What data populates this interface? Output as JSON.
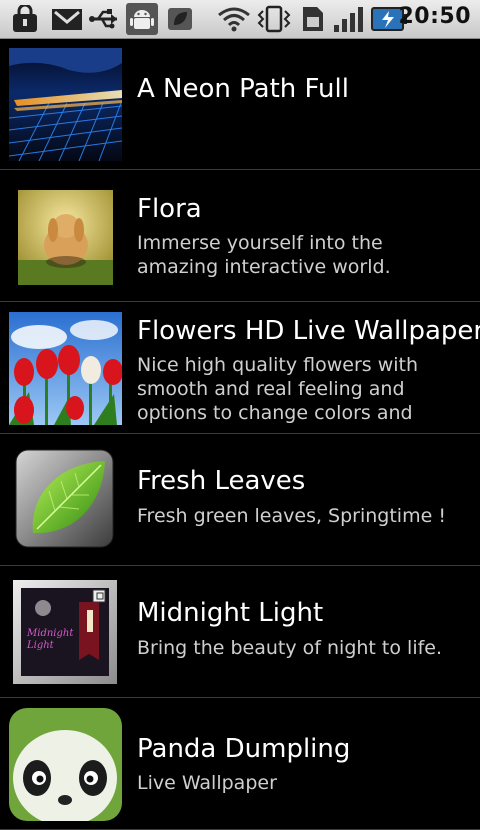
{
  "status_bar": {
    "time": "20:50",
    "icons": [
      "lock-icon",
      "gmail-icon",
      "usb-icon",
      "android-debug-icon",
      "leaf-icon",
      "wifi-icon",
      "vibrate-icon",
      "sim-icon",
      "signal-icon",
      "battery-charging-icon"
    ]
  },
  "colors": {
    "background": "#000000",
    "divider": "#3a3a3a",
    "title": "#ffffff",
    "description": "#cfcfcf"
  },
  "items": [
    {
      "title": "A Neon Path Full",
      "description": ""
    },
    {
      "title": "Flora",
      "description": "Immerse yourself into the amazing interactive world."
    },
    {
      "title": "Flowers HD Live Wallpaper",
      "description": "Nice high quality flowers with smooth and real feeling and options to change colors and"
    },
    {
      "title": "Fresh Leaves",
      "description": "Fresh green leaves, Springtime !"
    },
    {
      "title": "Midnight Light",
      "description": "Bring the beauty of night to life.",
      "thumb_text": "Midnight Light"
    },
    {
      "title": "Panda Dumpling",
      "description": "Live Wallpaper"
    }
  ]
}
